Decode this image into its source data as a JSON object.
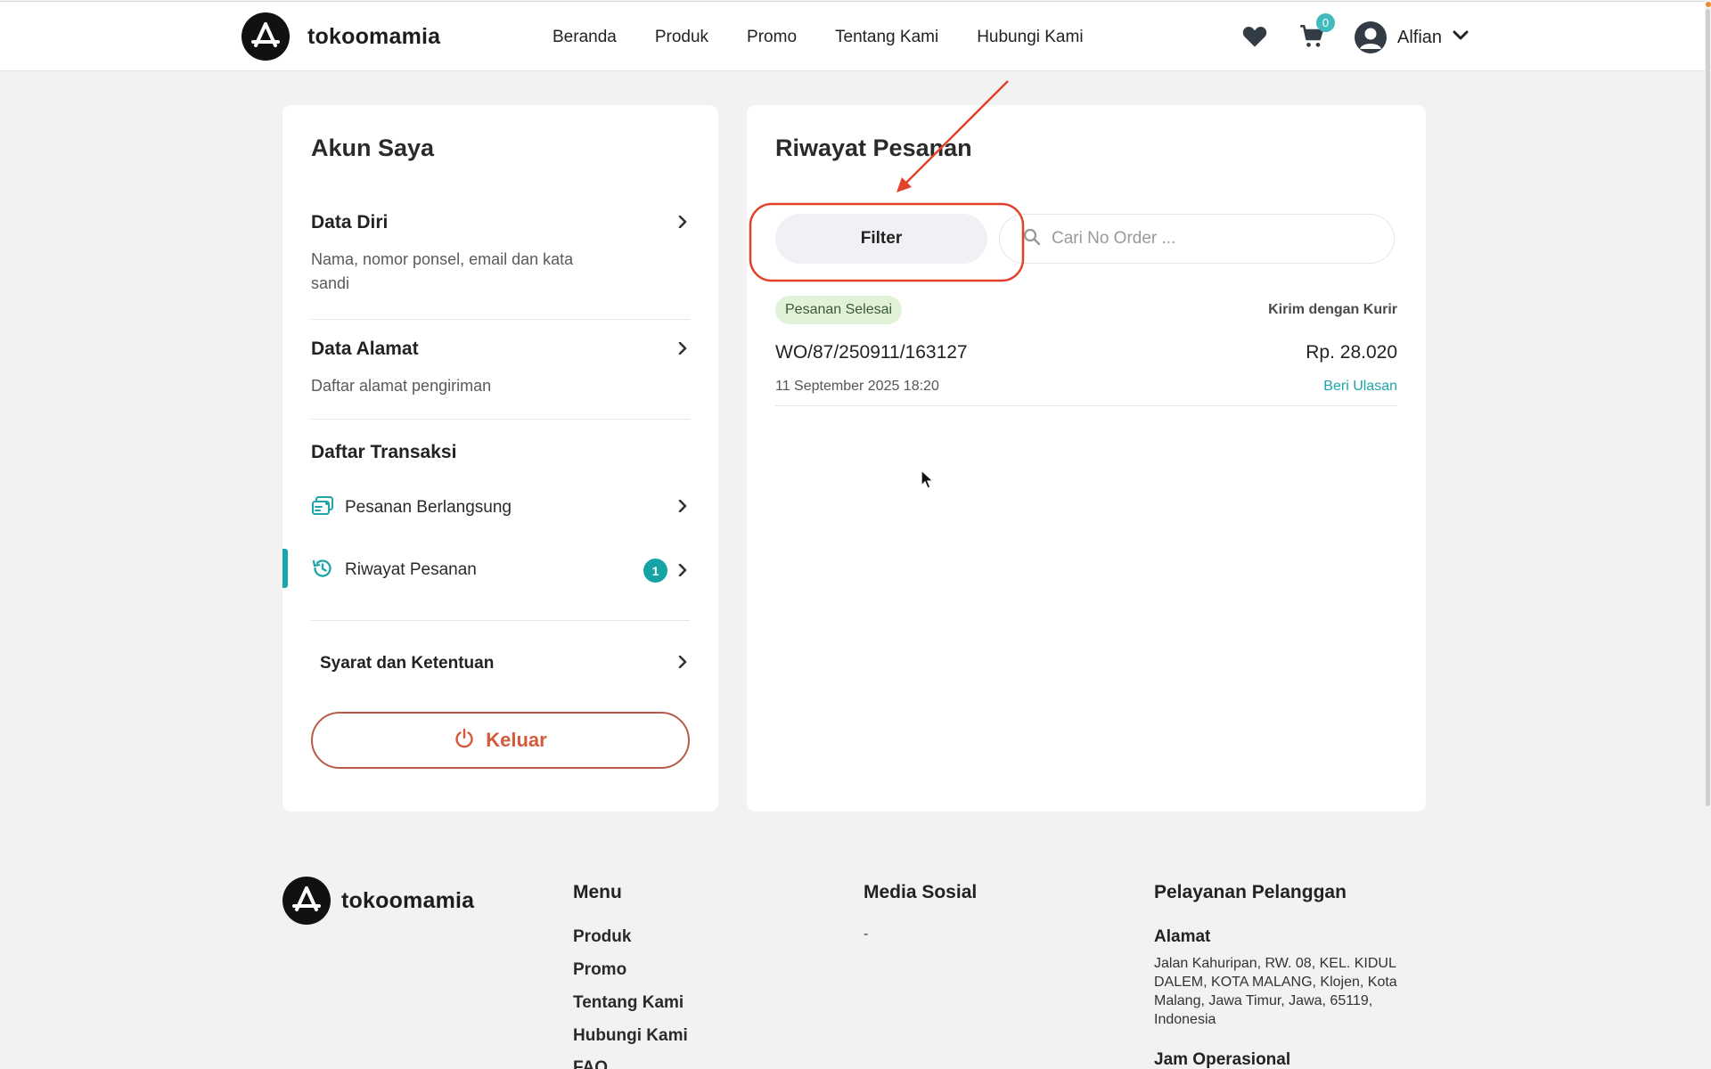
{
  "brand": {
    "name": "tokoomamia"
  },
  "nav": {
    "items": [
      {
        "label": "Beranda"
      },
      {
        "label": "Produk"
      },
      {
        "label": "Promo"
      },
      {
        "label": "Tentang Kami"
      },
      {
        "label": "Hubungi Kami"
      }
    ]
  },
  "header": {
    "cart_count": "0",
    "user_name": "Alfian"
  },
  "sidebar": {
    "title": "Akun Saya",
    "data_diri": {
      "title": "Data Diri",
      "desc": "Nama, nomor ponsel, email dan kata sandi"
    },
    "data_alamat": {
      "title": "Data Alamat",
      "desc": "Daftar alamat pengiriman"
    },
    "transaksi": {
      "title": "Daftar Transaksi",
      "items": [
        {
          "label": "Pesanan Berlangsung"
        },
        {
          "label": "Riwayat Pesanan",
          "badge": "1",
          "active": true
        }
      ]
    },
    "terms": "Syarat dan Ketentuan",
    "logout": "Keluar"
  },
  "main": {
    "title": "Riwayat Pesanan",
    "filter_label": "Filter",
    "search": {
      "placeholder": "Cari No Order ..."
    },
    "orders": [
      {
        "status": "Pesanan Selesai",
        "shipping": "Kirim dengan Kurir",
        "order_no": "WO/87/250911/163127",
        "price": "Rp. 28.020",
        "date": "11 September 2025 18:20",
        "action": "Beri Ulasan"
      }
    ]
  },
  "footer": {
    "brand": "tokoomamia",
    "menu": {
      "title": "Menu",
      "links": [
        "Produk",
        "Promo",
        "Tentang Kami",
        "Hubungi Kami",
        "FAQ"
      ]
    },
    "social": {
      "title": "Media Sosial",
      "value": "-"
    },
    "service": {
      "title": "Pelayanan Pelanggan",
      "address_title": "Alamat",
      "address": "Jalan Kahuripan, RW. 08, KEL. KIDUL DALEM, KOTA MALANG, Klojen, Kota Malang, Jawa Timur, Jawa, 65119, Indonesia",
      "hours_title": "Jam Operasional"
    }
  },
  "colors": {
    "accent": "#1da6a9",
    "danger": "#d35a3a",
    "annotation": "#e2412c"
  },
  "icons": [
    "heart-icon",
    "cart-icon",
    "user-avatar-icon",
    "chevron-down-icon",
    "chevron-right-icon",
    "search-icon",
    "orders-icon",
    "history-icon",
    "power-icon",
    "cursor-icon"
  ]
}
